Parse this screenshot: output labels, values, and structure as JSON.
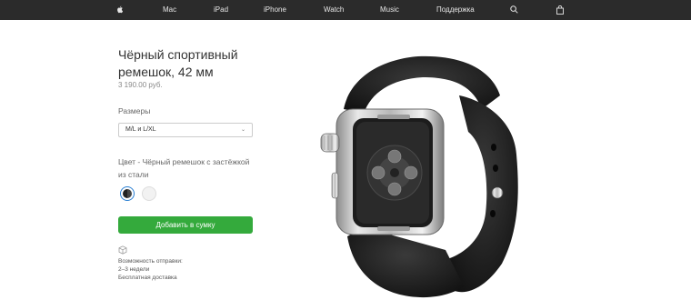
{
  "nav": {
    "items": [
      "Mac",
      "iPad",
      "iPhone",
      "Watch",
      "Music",
      "Поддержка"
    ],
    "apple_icon": "apple-logo-icon",
    "search_icon": "search-icon",
    "bag_icon": "shopping-bag-icon"
  },
  "product": {
    "title_line1": "Чёрный спортивный",
    "title_line2": "ремешок, 42 мм",
    "price": "3 190.00 руб."
  },
  "size": {
    "label": "Размеры",
    "selected": "M/L и L/XL"
  },
  "color": {
    "label": "Цвет - Чёрный ремешок с застёжкой из стали",
    "swatches": [
      "black",
      "white"
    ],
    "selected_color": "#222222",
    "alt_color": "#f2f2f2"
  },
  "cta": {
    "label": "Добавить в сумку",
    "color": "#34aa3c"
  },
  "shipping": {
    "line1": "Возможность отправки:",
    "line2": "2–3 недели",
    "line3": "Бесплатная доставка"
  }
}
